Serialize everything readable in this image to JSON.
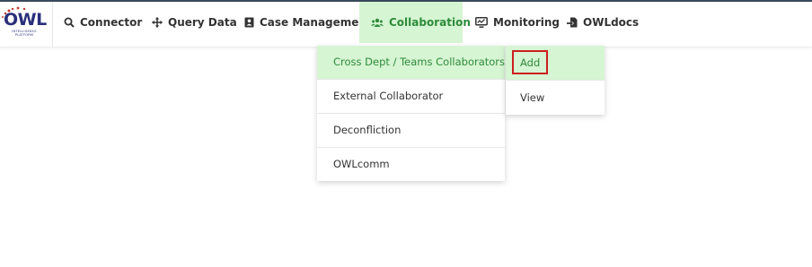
{
  "logo": {
    "text": "OWL",
    "subtitle": "INTELLIGENCE PLATFORM"
  },
  "nav": {
    "items": [
      {
        "label": "Connector",
        "icon": "search-icon"
      },
      {
        "label": "Query Data",
        "icon": "move-arrows-icon"
      },
      {
        "label": "Case Management",
        "icon": "address-book-icon"
      },
      {
        "label": "Collaboration",
        "icon": "users-icon",
        "active": true
      },
      {
        "label": "Monitoring",
        "icon": "monitor-chart-icon"
      },
      {
        "label": "OWLdocs",
        "icon": "file-import-icon"
      }
    ]
  },
  "dropdown": {
    "items": [
      {
        "label": "Cross Dept / Teams Collaborators",
        "active": true
      },
      {
        "label": "External Collaborator"
      },
      {
        "label": "Deconfliction"
      },
      {
        "label": "OWLcomm"
      }
    ]
  },
  "submenu": {
    "items": [
      {
        "label": "Add",
        "active": true
      },
      {
        "label": "View"
      }
    ]
  },
  "colors": {
    "accent": "#2e8b3a",
    "active_bg": "#d6f5d3",
    "highlight_border": "#cc1f1f",
    "topline": "#3a4a5c"
  }
}
